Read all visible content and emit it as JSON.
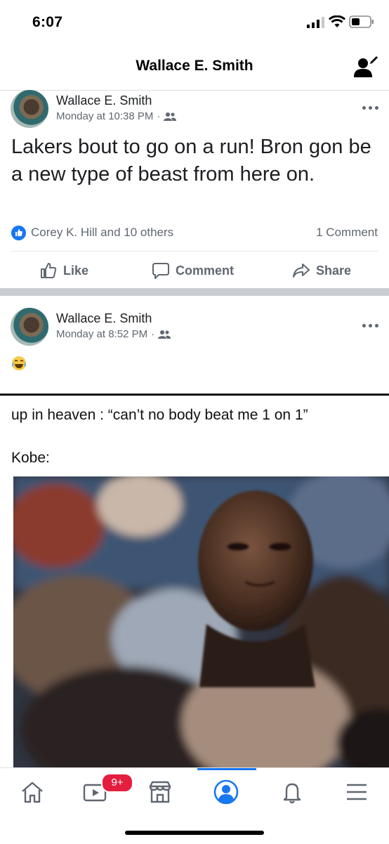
{
  "status_bar": {
    "time": "6:07"
  },
  "header": {
    "title": "Wallace E. Smith",
    "profile_icon": "person-edit-icon"
  },
  "posts": [
    {
      "author": "Wallace E. Smith",
      "timestamp": "Monday at 10:38 PM",
      "meta_separator": "·",
      "audience_icon": "friends-icon",
      "text": "Lakers bout to go on a run! Bron gon be a new type of beast from here on.",
      "reactions": "Corey K. Hill and 10 others",
      "comments": "1 Comment",
      "actions": {
        "like": "Like",
        "comment": "Comment",
        "share": "Share"
      }
    },
    {
      "author": "Wallace E. Smith",
      "timestamp": "Monday at 8:52 PM",
      "meta_separator": "·",
      "audience_icon": "friends-icon",
      "text_emoji": "laughing-tears-emoji",
      "meme": {
        "caption": "up in heaven : “can’t no body beat me 1 on 1”",
        "subject": "Kobe:"
      }
    }
  ],
  "tabbar": {
    "tabs": [
      "home-icon",
      "watch-icon",
      "marketplace-icon",
      "profile-icon",
      "notifications-icon",
      "menu-icon"
    ],
    "watch_badge": "9+",
    "active_tab": "profile-icon"
  },
  "colors": {
    "accent": "#1877f2",
    "badge": "#e41e3f",
    "separator": "#c9ccd1"
  }
}
